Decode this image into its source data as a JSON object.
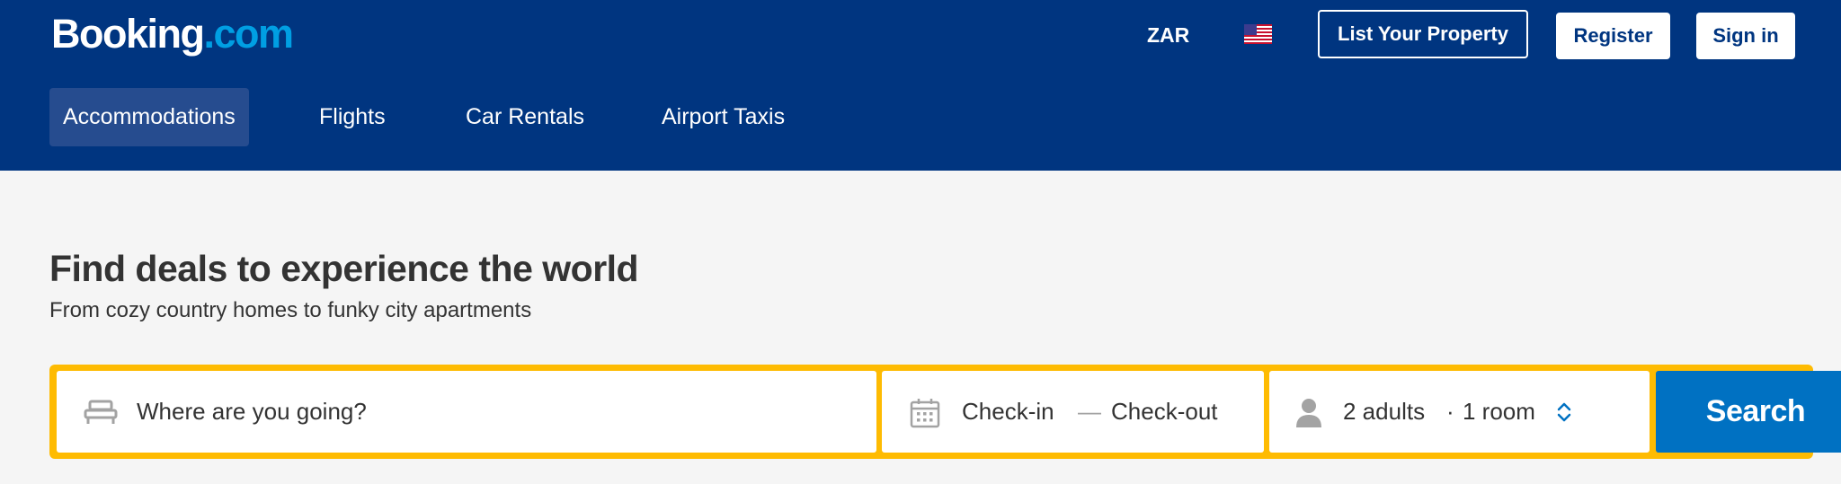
{
  "header": {
    "logo": {
      "main": "Booking",
      "dot": ".",
      "tld": "com"
    },
    "currency": "ZAR",
    "language_flag": "us-flag-icon",
    "list_property_label": "List Your Property",
    "register_label": "Register",
    "signin_label": "Sign in",
    "colors": {
      "background": "#003580",
      "logo_accent": "#009fe3"
    }
  },
  "nav": {
    "tabs": [
      {
        "label": "Accommodations",
        "active": true
      },
      {
        "label": "Flights",
        "active": false
      },
      {
        "label": "Car Rentals",
        "active": false
      },
      {
        "label": "Airport Taxis",
        "active": false
      }
    ]
  },
  "hero": {
    "title": "Find deals to experience the world",
    "subtitle": "From cozy country homes to funky city apartments"
  },
  "search": {
    "destination_placeholder": "Where are you going?",
    "destination_icon": "bed-icon",
    "checkin_label": "Check-in",
    "date_separator": "—",
    "checkout_label": "Check-out",
    "calendar_icon": "calendar-icon",
    "guests_adults": "2 adults",
    "guests_separator": "·",
    "guests_rooms": "1 room",
    "person_icon": "person-icon",
    "guests_toggle_icon": "up-down-chevron-icon",
    "search_label": "Search",
    "colors": {
      "border": "#febb02",
      "button": "#0071c2"
    }
  }
}
